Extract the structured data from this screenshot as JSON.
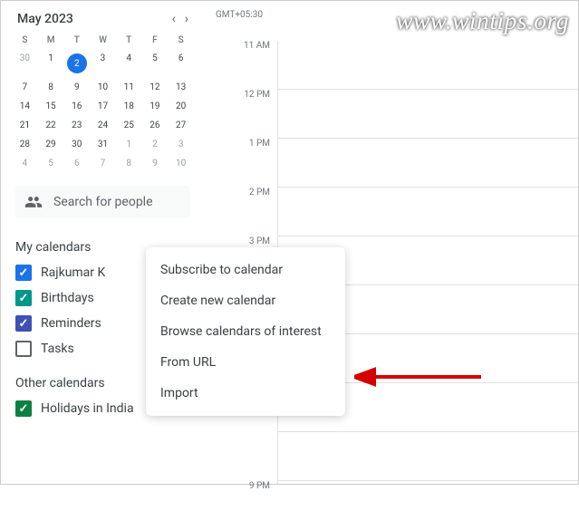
{
  "watermark": "www.wintips.org",
  "timezone": "GMT+05:30",
  "month": {
    "title": "May 2023",
    "dow": [
      "S",
      "M",
      "T",
      "W",
      "T",
      "F",
      "S"
    ],
    "weeks": [
      [
        {
          "n": "30",
          "faded": true
        },
        {
          "n": "1"
        },
        {
          "n": "2",
          "selected": true
        },
        {
          "n": "3"
        },
        {
          "n": "4"
        },
        {
          "n": "5"
        },
        {
          "n": "6"
        }
      ],
      [
        {
          "n": "7"
        },
        {
          "n": "8"
        },
        {
          "n": "9"
        },
        {
          "n": "10"
        },
        {
          "n": "11"
        },
        {
          "n": "12"
        },
        {
          "n": "13"
        }
      ],
      [
        {
          "n": "14"
        },
        {
          "n": "15"
        },
        {
          "n": "16"
        },
        {
          "n": "17"
        },
        {
          "n": "18"
        },
        {
          "n": "19"
        },
        {
          "n": "20"
        }
      ],
      [
        {
          "n": "21"
        },
        {
          "n": "22"
        },
        {
          "n": "23"
        },
        {
          "n": "24"
        },
        {
          "n": "25"
        },
        {
          "n": "26"
        },
        {
          "n": "27"
        }
      ],
      [
        {
          "n": "28"
        },
        {
          "n": "29"
        },
        {
          "n": "30"
        },
        {
          "n": "31"
        },
        {
          "n": "1",
          "faded": true
        },
        {
          "n": "2",
          "faded": true
        },
        {
          "n": "3",
          "faded": true
        }
      ],
      [
        {
          "n": "4",
          "faded": true
        },
        {
          "n": "5",
          "faded": true
        },
        {
          "n": "6",
          "faded": true
        },
        {
          "n": "7",
          "faded": true
        },
        {
          "n": "8",
          "faded": true
        },
        {
          "n": "9",
          "faded": true
        },
        {
          "n": "10",
          "faded": true
        }
      ]
    ]
  },
  "search": {
    "placeholder": "Search for people"
  },
  "sections": {
    "my": "My calendars",
    "other": "Other calendars"
  },
  "myCalendars": [
    {
      "label": "Rajkumar K",
      "color": "#1a73e8",
      "checked": true
    },
    {
      "label": "Birthdays",
      "color": "#009688",
      "checked": true
    },
    {
      "label": "Reminders",
      "color": "#3f51b5",
      "checked": true
    },
    {
      "label": "Tasks",
      "color": "#5f6368",
      "checked": false
    }
  ],
  "otherCalendars": [
    {
      "label": "Holidays in India",
      "color": "#0b8043",
      "checked": true
    }
  ],
  "hours": [
    "11 AM",
    "12 PM",
    "1 PM",
    "2 PM",
    "3 PM",
    "",
    "",
    "",
    "",
    "9 PM"
  ],
  "popup": {
    "items": [
      "Subscribe to calendar",
      "Create new calendar",
      "Browse calendars of interest",
      "From URL",
      "Import"
    ]
  }
}
